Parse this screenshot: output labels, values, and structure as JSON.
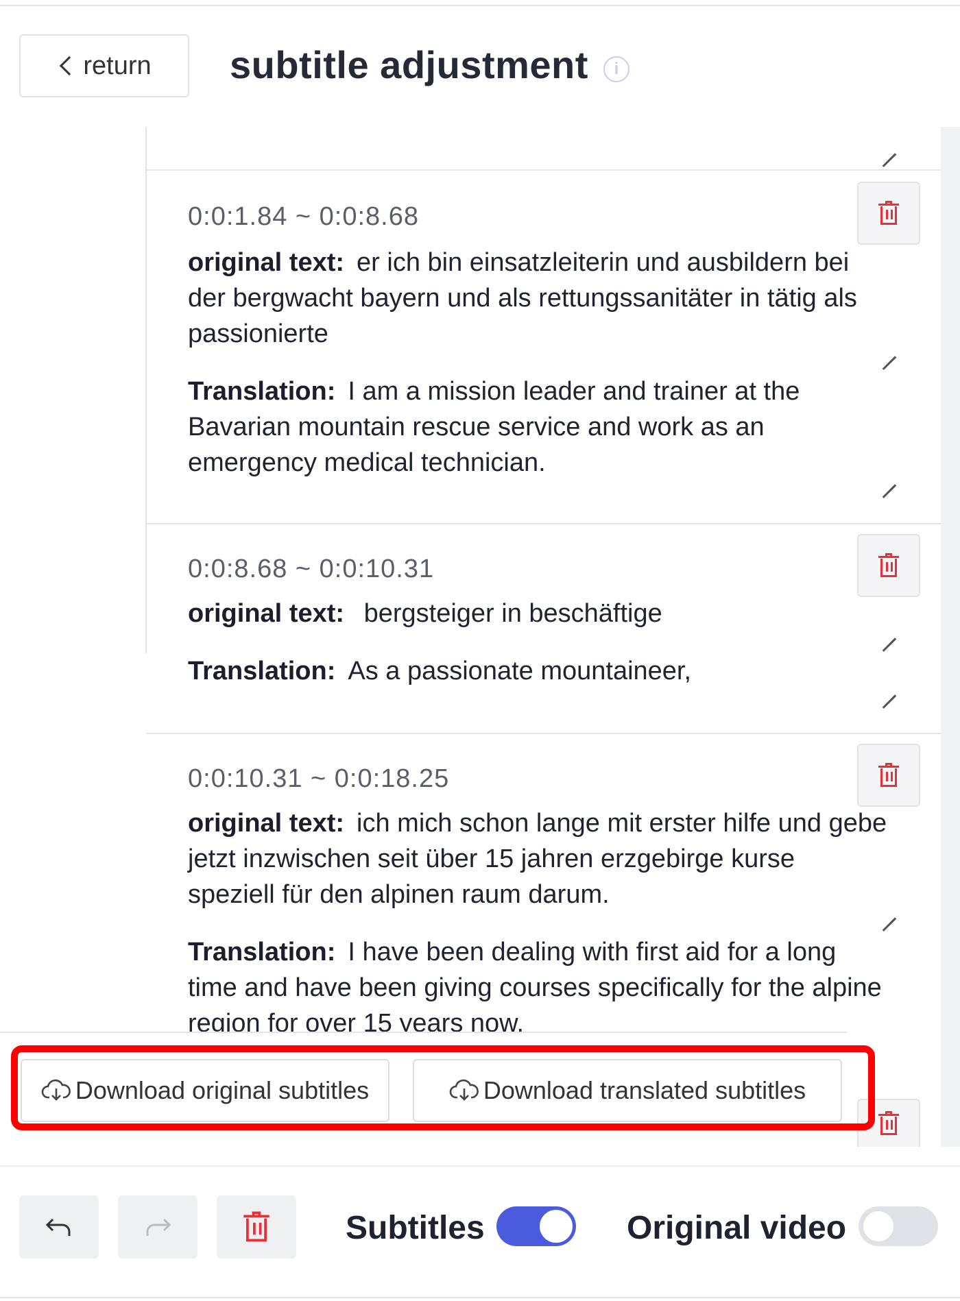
{
  "header": {
    "return_label": "return",
    "title": "subtitle adjustment",
    "info_icon": "info-circle-icon"
  },
  "subtitles": [
    {
      "time": "0:0:1.84 ~ 0:0:8.68",
      "original_label": "original text:",
      "original": "er ich bin einsatzleiterin und ausbildern bei der bergwacht bayern und als rettungssanitäter in tätig als passionierte",
      "translation_label": "Translation:",
      "translation": "I am a mission leader and trainer at the Bavarian mountain rescue service and work as an emergency medical technician."
    },
    {
      "time": "0:0:8.68 ~ 0:0:10.31",
      "original_label": "original text:",
      "original": " bergsteiger in beschäftige",
      "translation_label": "Translation:",
      "translation": "As a passionate mountaineer,"
    },
    {
      "time": "0:0:10.31 ~ 0:0:18.25",
      "original_label": "original text:",
      "original": "ich mich schon lange mit erster hilfe und gebe jetzt inzwischen seit über 15 jahren erzgebirge kurse speziell für den alpinen raum darum.",
      "translation_label": "Translation:",
      "translation": "I have been dealing with first aid for a long time and have been giving courses specifically for the alpine region for over 15 years now."
    }
  ],
  "download": {
    "original_label": "Download original subtitles",
    "translated_label": "Download translated subtitles",
    "icon": "cloud-download-icon"
  },
  "toolbar": {
    "undo_icon": "undo-icon",
    "redo_icon": "redo-icon",
    "delete_icon": "trash-icon",
    "subtitles_label": "Subtitles",
    "subtitles_on": true,
    "original_video_label": "Original video",
    "original_video_on": false
  },
  "colors": {
    "accent": "#4a5cdd",
    "danger": "#e8303a",
    "highlight": "#ff0000"
  }
}
